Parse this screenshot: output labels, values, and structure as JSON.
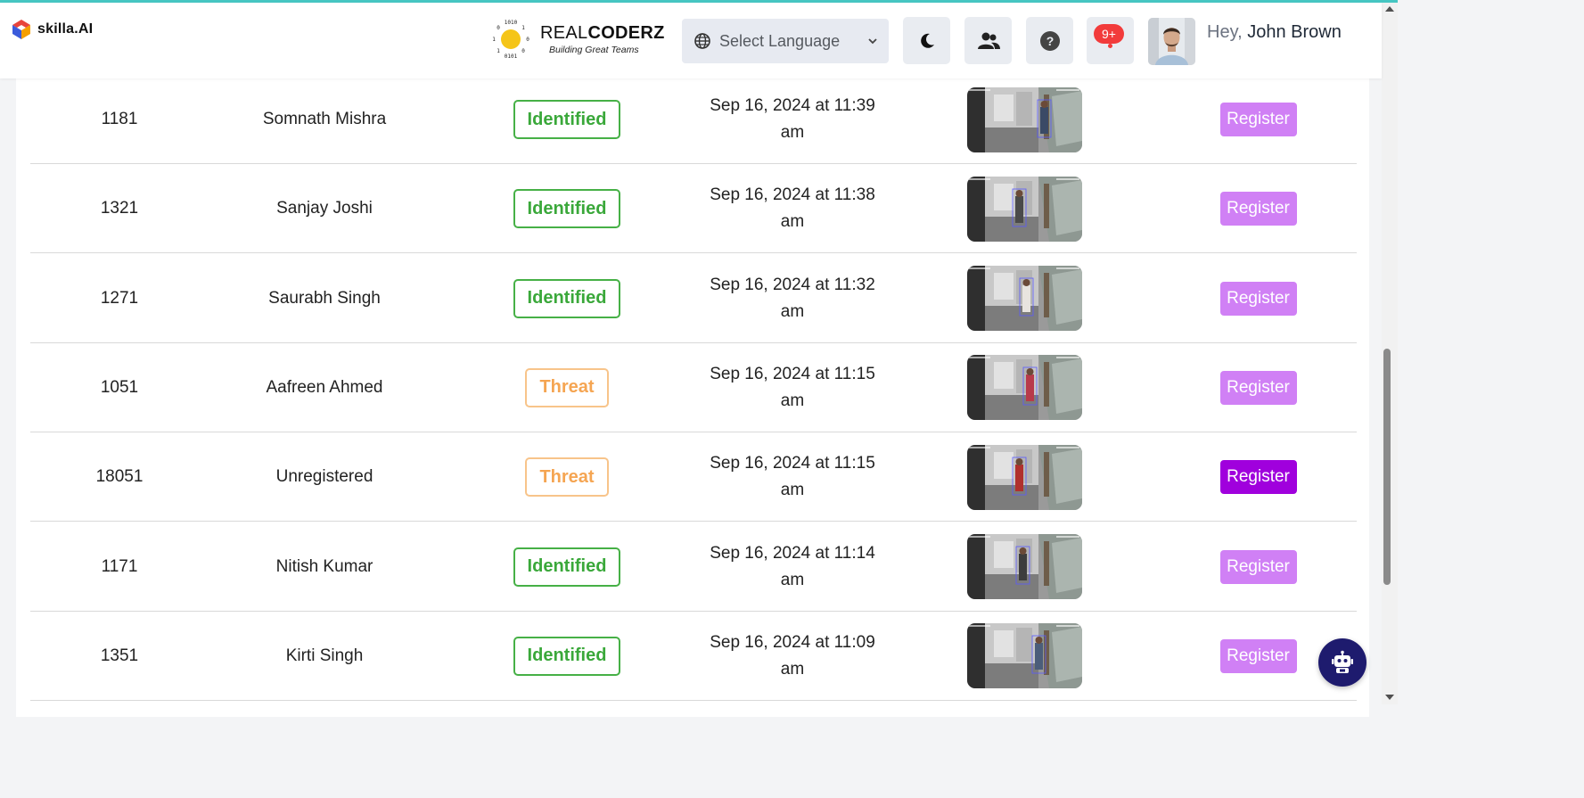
{
  "brand": {
    "name": "skilla.AI"
  },
  "org": {
    "name_regular": "REAL",
    "name_bold": "CODERZ",
    "tagline": "Building Great Teams"
  },
  "language": {
    "placeholder": "Select Language"
  },
  "notifications": {
    "count": "9+"
  },
  "user": {
    "greeting": "Hey,",
    "name": "John Brown"
  },
  "colors": {
    "identified": "#46b046",
    "threat": "#f8c48a",
    "register": "#d080f5",
    "register_active": "#a000dd",
    "bot": "#1e1b6e"
  },
  "rows": [
    {
      "id": "1181",
      "name": "Somnath Mishra",
      "status": "Identified",
      "status_type": "identified",
      "time_line1": "Sep 16, 2024 at 11:39",
      "time_line2": "am",
      "action": "Register",
      "active": false
    },
    {
      "id": "1321",
      "name": "Sanjay Joshi",
      "status": "Identified",
      "status_type": "identified",
      "time_line1": "Sep 16, 2024 at 11:38",
      "time_line2": "am",
      "action": "Register",
      "active": false
    },
    {
      "id": "1271",
      "name": "Saurabh Singh",
      "status": "Identified",
      "status_type": "identified",
      "time_line1": "Sep 16, 2024 at 11:32",
      "time_line2": "am",
      "action": "Register",
      "active": false
    },
    {
      "id": "1051",
      "name": "Aafreen Ahmed",
      "status": "Threat",
      "status_type": "threat",
      "time_line1": "Sep 16, 2024 at 11:15",
      "time_line2": "am",
      "action": "Register",
      "active": false
    },
    {
      "id": "18051",
      "name": "Unregistered",
      "status": "Threat",
      "status_type": "threat",
      "time_line1": "Sep 16, 2024 at 11:15",
      "time_line2": "am",
      "action": "Register",
      "active": true
    },
    {
      "id": "1171",
      "name": "Nitish Kumar",
      "status": "Identified",
      "status_type": "identified",
      "time_line1": "Sep 16, 2024 at 11:14",
      "time_line2": "am",
      "action": "Register",
      "active": false
    },
    {
      "id": "1351",
      "name": "Kirti Singh",
      "status": "Identified",
      "status_type": "identified",
      "time_line1": "Sep 16, 2024 at 11:09",
      "time_line2": "am",
      "action": "Register",
      "active": false
    }
  ]
}
